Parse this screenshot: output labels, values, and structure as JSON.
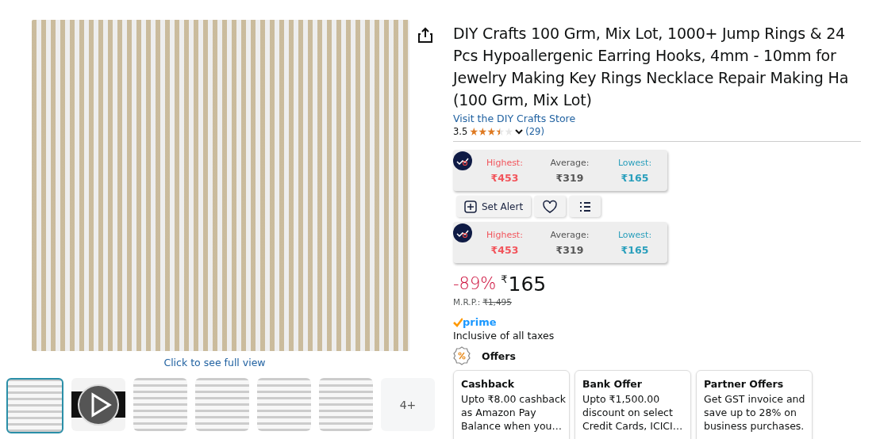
{
  "gallery": {
    "caption": "Click to see full view",
    "thumbnails": [
      {
        "kind": "image",
        "selected": true
      },
      {
        "kind": "video",
        "selected": false
      },
      {
        "kind": "image",
        "selected": false
      },
      {
        "kind": "image",
        "selected": false
      },
      {
        "kind": "image",
        "selected": false
      },
      {
        "kind": "image",
        "selected": false
      },
      {
        "kind": "more",
        "label": "4+",
        "selected": false
      }
    ]
  },
  "product": {
    "title": "DIY Crafts 100 Grm, Mix Lot, 1000+ Jump Rings & 24 Pcs Hypoallergenic Earring Hooks, 4mm - 10mm for Jewelry Making Key Rings Necklace Repair Making Ha (100 Grm, Mix Lot)",
    "store_link": "Visit the DIY Crafts Store",
    "rating": "3.5",
    "stars": 3.5,
    "review_count": "(29)"
  },
  "price_trackers": [
    {
      "stats": [
        {
          "kind": "high",
          "label": "Highest:",
          "value": "₹453"
        },
        {
          "kind": "avg",
          "label": "Average:",
          "value": "₹319"
        },
        {
          "kind": "low",
          "label": "Lowest:",
          "value": "₹165"
        }
      ]
    },
    {
      "stats": [
        {
          "kind": "high",
          "label": "Highest:",
          "value": "₹453"
        },
        {
          "kind": "avg",
          "label": "Average:",
          "value": "₹319"
        },
        {
          "kind": "low",
          "label": "Lowest:",
          "value": "₹165"
        }
      ]
    }
  ],
  "tracker_actions": {
    "set_alert": "Set Alert"
  },
  "price": {
    "discount": "-89%",
    "currency": "₹",
    "amount": "165",
    "mrp_label": "M.R.P.:",
    "mrp": "₹1,495"
  },
  "prime": "prime",
  "tax_note": "Inclusive of all taxes",
  "offers": {
    "heading": "Offers",
    "cards": [
      {
        "title": "Cashback",
        "text": "Upto ₹8.00 cashback as Amazon Pay Balance when you…"
      },
      {
        "title": "Bank Offer",
        "text": "Upto ₹1,500.00 discount on select Credit Cards, ICICI…"
      },
      {
        "title": "Partner Offers",
        "text": "Get GST invoice and save up to 28% on business purchases."
      }
    ]
  }
}
